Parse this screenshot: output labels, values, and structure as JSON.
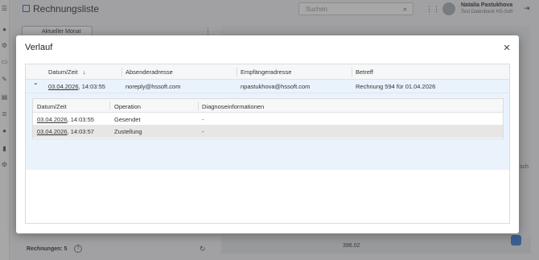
{
  "app": {
    "title": "Rechnungsliste",
    "search_placeholder": "Suchen",
    "user_name": "Natalia Pastukhova",
    "user_sub": "Test Datenbank HS-Soft",
    "tab_label": "Aktueller Monat",
    "side_text": "sch",
    "invoice_count": "Rechnungen: 5",
    "amount": "396.02"
  },
  "modal": {
    "title": "Verlauf",
    "columns": [
      "Datum/Zeit",
      "Absenderadresse",
      "Empfängeradresse",
      "Betreff"
    ],
    "row": {
      "date": "03.04.2026",
      "time": ", 14:03:55",
      "sender": "noreply@hssoft.com",
      "recipient": "npastukhova@hssoft.com",
      "subject": "Rechnung 594 für 01.04.2026"
    },
    "detail": {
      "columns": [
        "Datum/Zeit",
        "Operation",
        "Diagnoseinformationen"
      ],
      "rows": [
        {
          "date": "03.04.2026",
          "time": ", 14:03:55",
          "operation": "Gesendet",
          "diagnostics": "-"
        },
        {
          "date": "03.04.2026",
          "time": ", 14:03:57",
          "operation": "Zustellung",
          "diagnostics": "-"
        }
      ]
    }
  },
  "icons": {
    "sort": "arrow-down-icon",
    "expand": "chevron-up-icon",
    "close": "close-icon"
  },
  "colors": {
    "accent": "#2a6ab8",
    "row_highlight": "#eaf3fb"
  }
}
